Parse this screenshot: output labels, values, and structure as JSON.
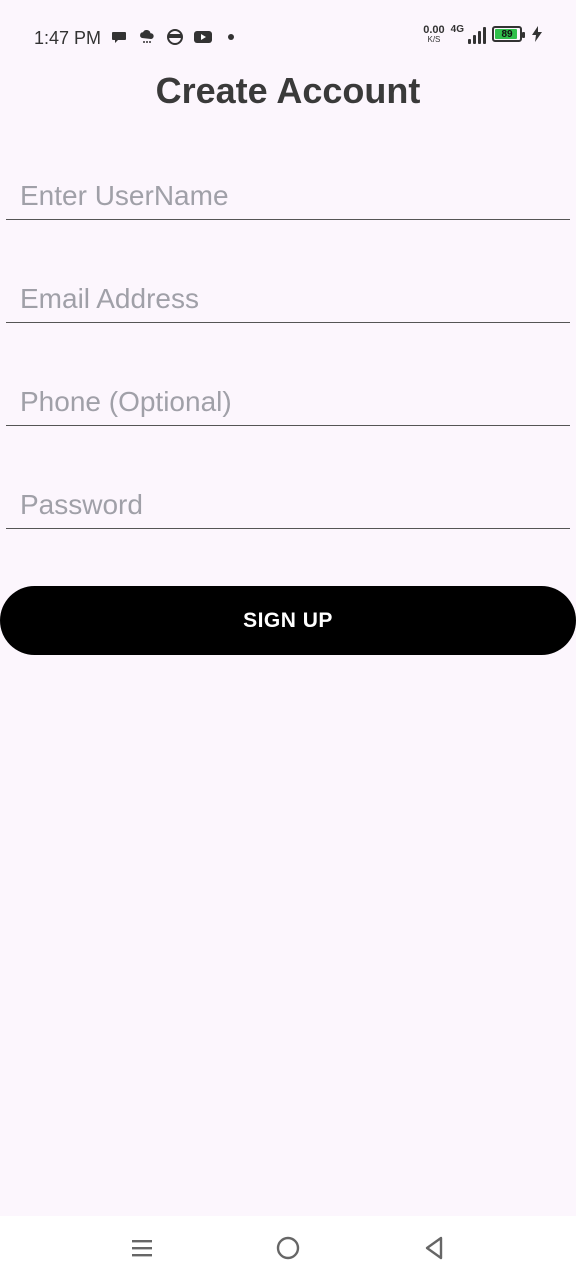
{
  "status_bar": {
    "time": "1:47 PM",
    "left_icons": [
      "chat-bubble-icon",
      "cloud-rain-icon",
      "circle-app-icon",
      "youtube-icon",
      "dot-icon"
    ],
    "net_speed_value": "0.00",
    "net_speed_unit": "K/S",
    "network_type": "4G",
    "battery_level": "89",
    "battery_color": "#2fbf4a",
    "charging_icon": "bolt-icon"
  },
  "page": {
    "title": "Create Account"
  },
  "form": {
    "username_placeholder": "Enter UserName",
    "email_placeholder": "Email Address",
    "phone_placeholder": "Phone (Optional)",
    "password_placeholder": "Password",
    "signup_label": "SIGN UP"
  },
  "nav_bar": {
    "icons": [
      "menu-icon",
      "home-icon",
      "back-icon"
    ]
  },
  "colors": {
    "background": "#fcf6fd",
    "button": "#000000",
    "button_text": "#ffffff",
    "placeholder": "#a0a0a8"
  }
}
